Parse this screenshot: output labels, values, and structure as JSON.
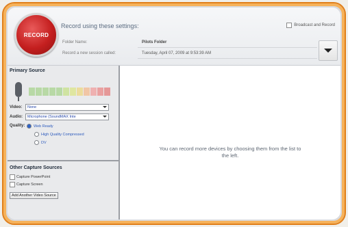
{
  "header": {
    "record_label": "RECORD",
    "settings_title": "Record using these settings:",
    "broadcast_label": "Broadcast and Record",
    "folder_name_label": "Folder Name:",
    "folder_name_value": "Pilots Folder",
    "session_label": "Record a new session called:",
    "session_value": "Tuesday, April 07, 2009 at 9:53:39 AM"
  },
  "primary_source": {
    "title": "Primary Source",
    "video_label": "Video:",
    "video_value": "None",
    "audio_label": "Audio:",
    "audio_value": "Microphone (SoundMAX Inte",
    "quality_label": "Quality:",
    "quality_options": [
      "Web Ready",
      "High Quality Compressed",
      "DV"
    ],
    "selected_quality": "Web Ready",
    "meter_colors": [
      "#b8d9a6",
      "#b8d9a6",
      "#b8d9a6",
      "#b8d9a6",
      "#b8d9a6",
      "#cfe3a2",
      "#dfe6a0",
      "#ecdc9c",
      "#f1c6a6",
      "#efb1b1",
      "#eaa1a1",
      "#e59898"
    ]
  },
  "other_sources": {
    "title": "Other Capture Sources",
    "capture_powerpoint": "Capture PowerPoint",
    "capture_screen": "Capture Screen",
    "add_button": "Add Another Video Source"
  },
  "main": {
    "message": "You can record more devices by choosing them from the list to the left."
  }
}
